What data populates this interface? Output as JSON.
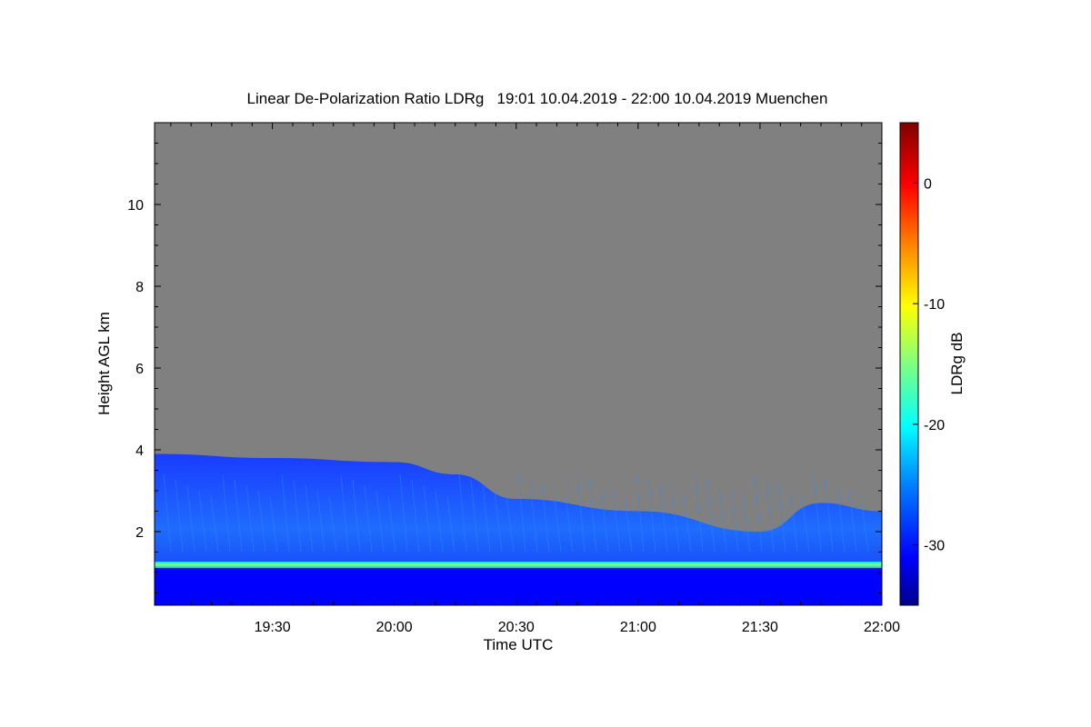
{
  "chart_data": {
    "type": "heatmap",
    "title": "Linear De-Polarization Ratio LDRg   19:01 10.04.2019 - 22:00 10.04.2019 Muenchen",
    "xlabel": "Time UTC",
    "ylabel": "Height AGL km",
    "xlim": [
      "19:01",
      "22:00"
    ],
    "ylim": [
      0.2,
      12
    ],
    "x_ticks": [
      "19:30",
      "20:00",
      "20:30",
      "21:00",
      "21:30",
      "22:00"
    ],
    "y_ticks": [
      2,
      4,
      6,
      8,
      10
    ],
    "grid": false,
    "colorbar": {
      "label": "LDRg dB",
      "range": [
        -35,
        5
      ],
      "ticks": [
        0,
        -10,
        -20,
        -30
      ],
      "colors": [
        "#00008b",
        "#0000ff",
        "#0080ff",
        "#00ffff",
        "#80ff80",
        "#ffff00",
        "#ff8000",
        "#ff0000",
        "#800000"
      ]
    },
    "no_signal_color": "#808080",
    "features": [
      {
        "kind": "cloud_layer",
        "ldr_db": -28,
        "top_km": [
          3.9,
          3.8,
          3.7,
          3.4,
          2.8,
          2.5,
          2.0,
          2.7,
          2.5
        ],
        "times": [
          "19:01",
          "19:30",
          "20:00",
          "20:15",
          "20:30",
          "21:00",
          "21:30",
          "21:45",
          "22:00"
        ]
      },
      {
        "kind": "layer_band",
        "ldr_db": -15,
        "height_km": 1.2
      }
    ]
  }
}
